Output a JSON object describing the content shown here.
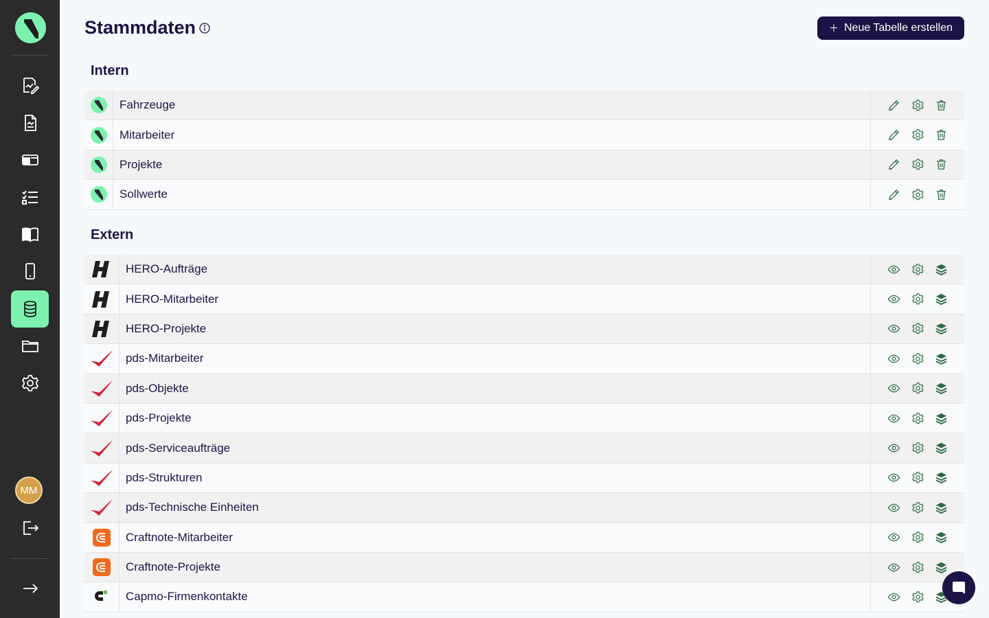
{
  "app": {
    "avatar_initials": "MM",
    "accent_color": "#7df2b0",
    "dark_color": "#1c1446"
  },
  "sidebar": {
    "items": [
      {
        "icon": "edit-document-icon"
      },
      {
        "icon": "report-document-icon"
      },
      {
        "icon": "inbox-icon"
      },
      {
        "icon": "checklist-icon"
      },
      {
        "icon": "book-icon"
      },
      {
        "icon": "mobile-icon"
      },
      {
        "icon": "database-icon",
        "active": true
      },
      {
        "icon": "folder-icon"
      },
      {
        "icon": "gear-icon"
      }
    ]
  },
  "header": {
    "title": "Stammdaten",
    "new_button_label": "Neue Tabelle erstellen"
  },
  "intern": {
    "title": "Intern",
    "rows": [
      {
        "name": "Fahrzeuge"
      },
      {
        "name": "Mitarbeiter"
      },
      {
        "name": "Projekte"
      },
      {
        "name": "Sollwerte"
      }
    ]
  },
  "extern": {
    "title": "Extern",
    "rows": [
      {
        "name": "HERO-Aufträge",
        "logo": "hero-logo"
      },
      {
        "name": "HERO-Mitarbeiter",
        "logo": "hero-logo"
      },
      {
        "name": "HERO-Projekte",
        "logo": "hero-logo"
      },
      {
        "name": "pds-Mitarbeiter",
        "logo": "pds-logo"
      },
      {
        "name": "pds-Objekte",
        "logo": "pds-logo"
      },
      {
        "name": "pds-Projekte",
        "logo": "pds-logo"
      },
      {
        "name": "pds-Serviceaufträge",
        "logo": "pds-logo"
      },
      {
        "name": "pds-Strukturen",
        "logo": "pds-logo"
      },
      {
        "name": "pds-Technische Einheiten",
        "logo": "pds-logo"
      },
      {
        "name": "Craftnote-Mitarbeiter",
        "logo": "craftnote-logo"
      },
      {
        "name": "Craftnote-Projekte",
        "logo": "craftnote-logo"
      },
      {
        "name": "Capmo-Firmenkontakte",
        "logo": "capmo-logo"
      }
    ]
  }
}
